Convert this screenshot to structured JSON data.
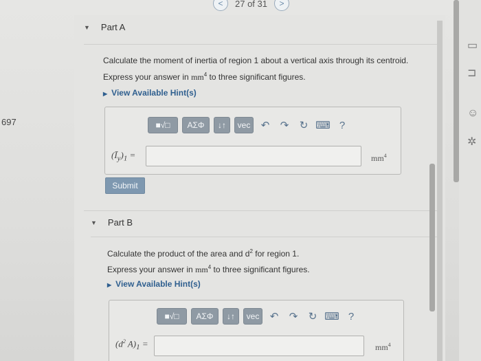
{
  "pager": {
    "text": "27 of 31",
    "prev": "<",
    "next": ">"
  },
  "side_number": "697",
  "part_a": {
    "title": "Part A",
    "question": "Calculate the moment of inertia of region 1 about a vertical axis through its centroid.",
    "instruction_pre": "Express your answer in ",
    "instruction_unit": "mm",
    "instruction_exp": "4",
    "instruction_post": " to three significant figures.",
    "hint": "View Available Hint(s)",
    "toolbar": {
      "templates": "■√□",
      "greek": "ΑΣΦ",
      "arrows": "↓↑",
      "vec": "vec",
      "undo": "↶",
      "redo": "↷",
      "reset": "↻",
      "keyboard": "⌨",
      "help": "?"
    },
    "label": "(Ī",
    "label_sub": "y",
    "label_post": ")",
    "label_sub2": "1",
    "label_eq": " =",
    "input_value": "",
    "unit": "mm",
    "unit_exp": "4",
    "submit": "Submit"
  },
  "part_b": {
    "title": "Part B",
    "question_pre": "Calculate the product of the area and d",
    "question_exp": "2",
    "question_post": " for region 1.",
    "instruction_pre": "Express your answer in ",
    "instruction_unit": "mm",
    "instruction_exp": "4",
    "instruction_post": " to three significant figures.",
    "hint": "View Available Hint(s)",
    "toolbar": {
      "templates": "■√□",
      "greek": "ΑΣΦ",
      "arrows": "↓↑",
      "vec": "vec",
      "undo": "↶",
      "redo": "↷",
      "reset": "↻",
      "keyboard": "⌨",
      "help": "?"
    },
    "label": "(d",
    "label_exp": "2",
    "label_mid": " A)",
    "label_sub": "1",
    "label_eq": " =",
    "input_value": "",
    "unit": "mm",
    "unit_exp": "4"
  },
  "colors": {
    "accent": "#7e98b0",
    "link": "#2f5f8f",
    "toolbar_btn": "#8f9aa4"
  }
}
